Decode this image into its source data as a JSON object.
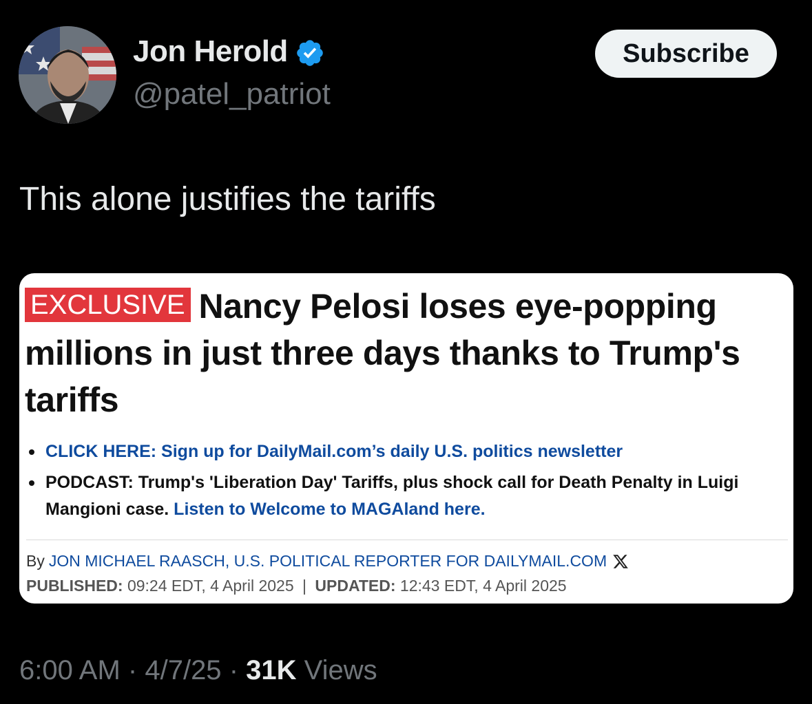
{
  "author": {
    "name": "Jon Herold",
    "handle": "@patel_patriot",
    "verified_color": "#1d9bf0"
  },
  "subscribe_label": "Subscribe",
  "tweet_text": "This alone justifies the tariffs",
  "article": {
    "badge": "EXCLUSIVE",
    "headline": "Nancy Pelosi loses eye-popping millions in just three days thanks to Trump's tariffs",
    "bullet1": "CLICK HERE: Sign up for DailyMail.com’s daily U.S. politics newsletter",
    "bullet2_text": "PODCAST: Trump's 'Liberation Day' Tariffs, plus shock call for Death Penalty in Luigi Mangioni case.",
    "bullet2_link": "Listen to Welcome to MAGAland here.",
    "by_prefix": "By",
    "author_credit": "JON MICHAEL RAASCH, U.S. POLITICAL REPORTER FOR DAILYMAIL.COM",
    "published_label": "PUBLISHED:",
    "published_value": "09:24 EDT, 4 April 2025",
    "date_separator": "|",
    "updated_label": "UPDATED:",
    "updated_value": "12:43 EDT, 4 April 2025",
    "badge_color": "#e2363c",
    "link_color": "#0f4b9e"
  },
  "meta": {
    "time": "6:00 AM",
    "dot1": "·",
    "date": "4/7/25",
    "dot2": "·",
    "views_count": "31K",
    "views_label": "Views"
  },
  "icons": [
    "avatar-photo",
    "verified-badge-icon",
    "x-logo-icon"
  ]
}
